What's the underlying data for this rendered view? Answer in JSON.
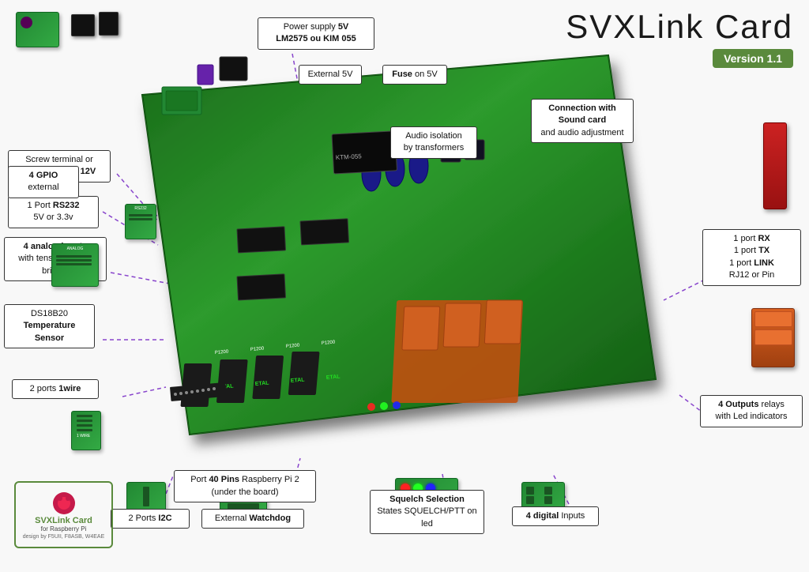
{
  "title": "SVXLink Card",
  "version": "Version 1.1",
  "annotations": {
    "power_supply": {
      "label": "Power supply 5V\nLM2575 ou KIM 055",
      "bold_part": "5V"
    },
    "external_5v": {
      "label": "External 5V"
    },
    "fuse_5v": {
      "label": "Fuse on 5V",
      "bold_part": "Fuse"
    },
    "audio_isolation": {
      "label": "Audio isolation\nby transformers"
    },
    "connection_sound": {
      "label": "Connection with\nSound card\nand audio adjustment"
    },
    "screw_terminal": {
      "label": "Screw terminal or\nConnector DC 12V"
    },
    "rs232": {
      "label": "1 Port RS232\n5V or 3.3v",
      "bold_part": "RS232"
    },
    "gpio": {
      "label": "4 GPIO\nexternal",
      "bold_part": "4 GPIO"
    },
    "analog_inputs": {
      "label": "4 analog inputs\nwith tension divider\nbridge.",
      "bold_part": "4 analog inputs"
    },
    "temperature": {
      "label": "DS18B20\nTemperature\nSensor",
      "bold_part": "Temperature\nSensor"
    },
    "onewire": {
      "label": "2 ports 1wire",
      "bold_part": "1wire"
    },
    "rx_tx_link": {
      "label": "1 port RX\n1 port TX\n1 port LINK\nRJ12 or Pin",
      "bold_parts": [
        "RX",
        "TX",
        "LINK"
      ]
    },
    "port_40pins": {
      "label": "Port 40 Pins Raspberry Pi 2\n(under the board)",
      "bold_part": "40 Pins"
    },
    "ports_i2c": {
      "label": "2 Ports I2C",
      "bold_part": "I2C"
    },
    "external_watchdog": {
      "label": "External Watchdog",
      "bold_part": "Watchdog"
    },
    "squelch": {
      "label": "Squelch Selection\nStates SQUELCH/PTT on led",
      "bold_part": "Squelch Selection"
    },
    "digital_inputs": {
      "label": "4 digital Inputs",
      "bold_part": "4 digital"
    },
    "outputs_relays": {
      "label": "4 Outputs relays\nwith Led indicators",
      "bold_part": "4 Outputs"
    }
  },
  "logo": {
    "main": "SVXLink Card",
    "sub": "for Raspberry Pi",
    "design": "design by\nF5UII, F8ASB, W4EAE"
  },
  "colors": {
    "pcb_green": "#2d8b2d",
    "version_green": "#5a8a3c",
    "annotation_border": "#333333",
    "relay_orange": "#e87020",
    "connector_line": "#8844aa"
  }
}
